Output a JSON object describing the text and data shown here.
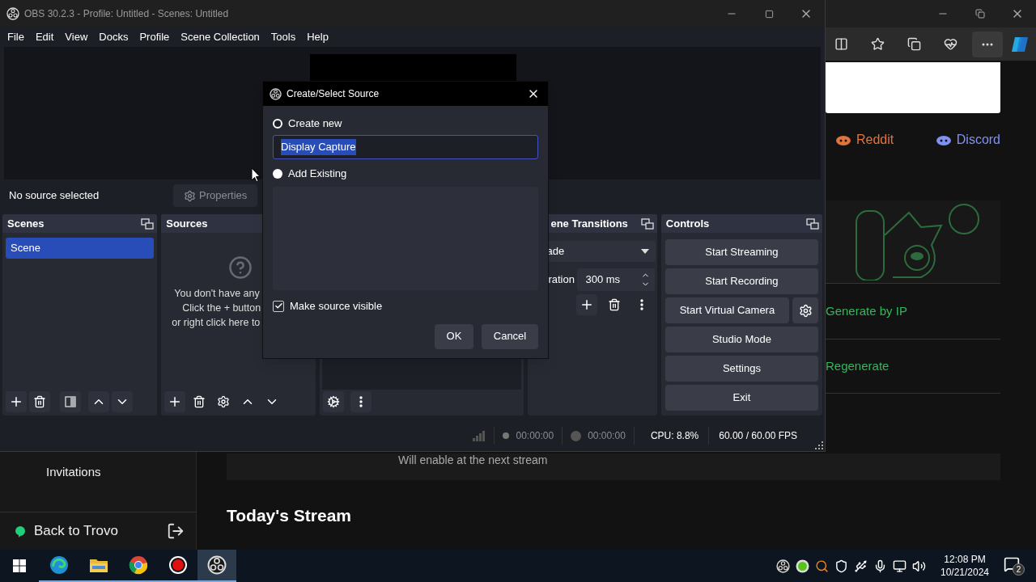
{
  "browser": {
    "links": [
      {
        "label": "Reddit",
        "color": "#e0743c"
      },
      {
        "label": "Discord",
        "color": "#8191f0"
      }
    ],
    "actions": [
      "Generate by IP",
      "Regenerate"
    ],
    "note": "Will enable at the next stream",
    "sidebar_items": [
      "Invitations"
    ],
    "back_link": "Back to Trovo",
    "heading": "Today's Stream"
  },
  "obs": {
    "title": "OBS 30.2.3 - Profile: Untitled - Scenes: Untitled",
    "menu": [
      "File",
      "Edit",
      "View",
      "Docks",
      "Profile",
      "Scene Collection",
      "Tools",
      "Help"
    ],
    "source_bar": {
      "text": "No source selected",
      "properties": "Properties"
    },
    "scenes": {
      "title": "Scenes",
      "items": [
        {
          "label": "Scene",
          "selected": true
        }
      ]
    },
    "sources": {
      "title": "Sources",
      "empty_lines": [
        "You don't have any",
        "Click the + button",
        "or right click here to"
      ]
    },
    "transitions": {
      "title": "ene Transitions",
      "transition": "ade",
      "duration_label": "ration",
      "duration": "300 ms"
    },
    "controls": {
      "title": "Controls",
      "buttons": [
        {
          "label": "Start Streaming",
          "kind": "plain"
        },
        {
          "label": "Start Recording",
          "kind": "plain"
        },
        {
          "label": "Start Virtual Camera",
          "kind": "with_settings"
        },
        {
          "label": "Studio Mode",
          "kind": "plain"
        },
        {
          "label": "Settings",
          "kind": "plain"
        },
        {
          "label": "Exit",
          "kind": "plain"
        }
      ]
    },
    "status_bar": {
      "stream_time": "00:00:00",
      "record_time": "00:00:00",
      "cpu": "CPU: 8.8%",
      "fps": "60.00 / 60.00 FPS"
    }
  },
  "dialog": {
    "title": "Create/Select Source",
    "options": [
      {
        "label": "Create new",
        "selected": true
      },
      {
        "label": "Add Existing",
        "selected": false
      }
    ],
    "name_value": "Display Capture",
    "make_visible": {
      "label": "Make source visible",
      "checked": true
    },
    "buttons": [
      "OK",
      "Cancel"
    ]
  },
  "taskbar": {
    "time": "12:08 PM",
    "date": "10/21/2024",
    "notifications": "2"
  }
}
